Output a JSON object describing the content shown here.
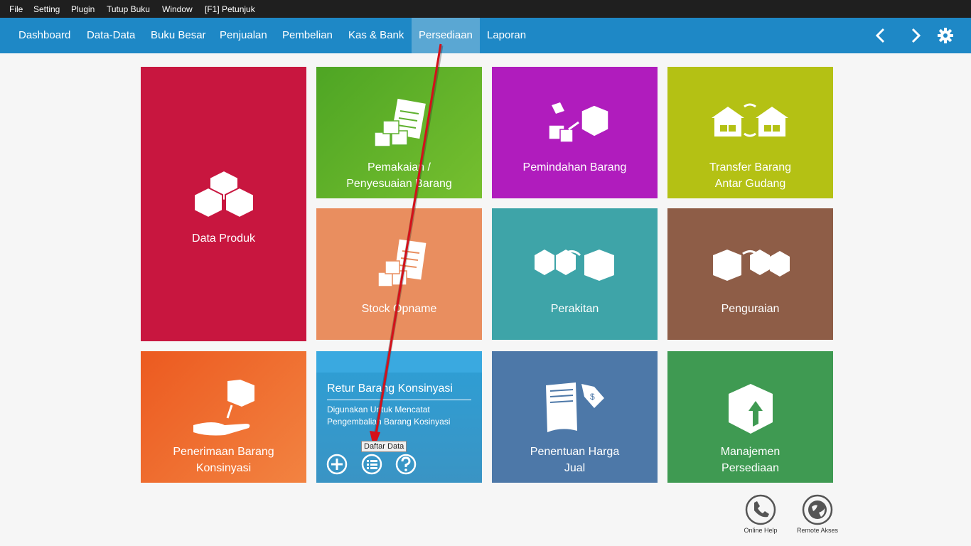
{
  "menubar": {
    "items": [
      "File",
      "Setting",
      "Plugin",
      "Tutup Buku",
      "Window",
      "[F1] Petunjuk"
    ]
  },
  "nav": {
    "items": [
      "Dashboard",
      "Data-Data",
      "Buku Besar",
      "Penjualan",
      "Pembelian",
      "Kas & Bank",
      "Persediaan",
      "Laporan"
    ],
    "active": "Persediaan"
  },
  "tiles": {
    "data_produk": {
      "label": "Data Produk",
      "color": "#c8163f"
    },
    "pemakaian": {
      "label1": "Pemakaian /",
      "label2": "Penyesuaian Barang",
      "color": "#5fb130"
    },
    "pemindahan": {
      "label": "Pemindahan Barang",
      "color": "#b01cbd"
    },
    "transfer": {
      "label1": "Transfer Barang",
      "label2": "Antar Gudang",
      "color": "#b4c114"
    },
    "stock_opname": {
      "label": "Stock Opname",
      "color": "#e98e5f"
    },
    "perakitan": {
      "label": "Perakitan",
      "color": "#3ea4a8"
    },
    "penguraian": {
      "label": "Penguraian",
      "color": "#8e5d47"
    },
    "penerimaan": {
      "label1": "Penerimaan Barang",
      "label2": "Konsinyasi",
      "color": "#ef6a2c"
    },
    "retur": {
      "title": "Retur Barang Konsinyasi",
      "desc1": "Digunakan Untuk Mencatat",
      "desc2": "Pengembalian Barang Kosinyasi",
      "color": "#2f9ad3"
    },
    "penentuan": {
      "label1": "Penentuan Harga",
      "label2": "Jual",
      "color": "#4d78a8"
    },
    "manajemen": {
      "label1": "Manajemen",
      "label2": "Persediaan",
      "color": "#3f9a52"
    }
  },
  "tooltip": "Daftar Data",
  "footer": {
    "online_help": "Online Help",
    "remote_akses": "Remote Akses"
  },
  "icons": [
    "chevron-left-icon",
    "chevron-right-icon",
    "gear-icon",
    "boxes-icon",
    "plus-circle-icon",
    "list-icon",
    "help-icon",
    "phone-icon",
    "globe-icon"
  ]
}
